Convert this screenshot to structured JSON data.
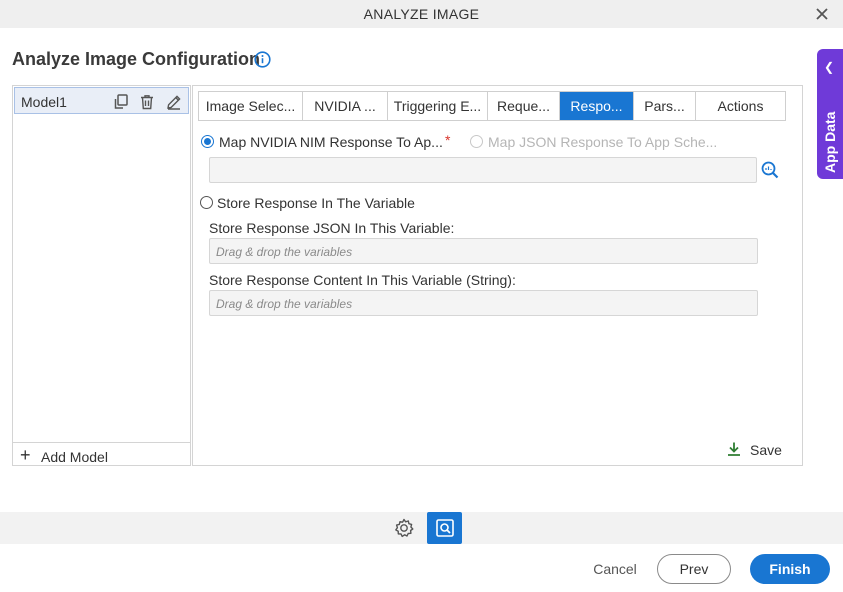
{
  "window": {
    "title": "ANALYZE IMAGE"
  },
  "page": {
    "heading": "Analyze Image Configuration"
  },
  "side_tab": {
    "label": "App Data"
  },
  "models": {
    "items": [
      {
        "name": "Model1"
      }
    ],
    "add_label": "Add Model"
  },
  "tabs": [
    {
      "label": "Image Selec..."
    },
    {
      "label": "NVIDIA ..."
    },
    {
      "label": "Triggering E..."
    },
    {
      "label": "Reque..."
    },
    {
      "label": "Respo...",
      "active": true
    },
    {
      "label": "Pars..."
    },
    {
      "label": "Actions"
    }
  ],
  "response": {
    "option_map_nim": {
      "label": "Map NVIDIA NIM Response To Ap...",
      "selected": true,
      "required_mark": "*"
    },
    "option_map_json": {
      "label": "Map JSON Response To App Sche...",
      "selected": false,
      "disabled": true
    },
    "option_store_var": {
      "label": "Store Response In The Variable",
      "selected": false
    },
    "store_json_label": "Store Response JSON In This Variable:",
    "store_json_placeholder": "Drag & drop the variables",
    "store_content_label": "Store Response Content In This Variable (String):",
    "store_content_placeholder": "Drag & drop the variables",
    "save_label": "Save"
  },
  "footer": {
    "cancel_label": "Cancel",
    "prev_label": "Prev",
    "finish_label": "Finish"
  },
  "colors": {
    "accent": "#1976d2",
    "app_data_tab": "#6f3ad8",
    "save_icon": "#2e7d32"
  }
}
